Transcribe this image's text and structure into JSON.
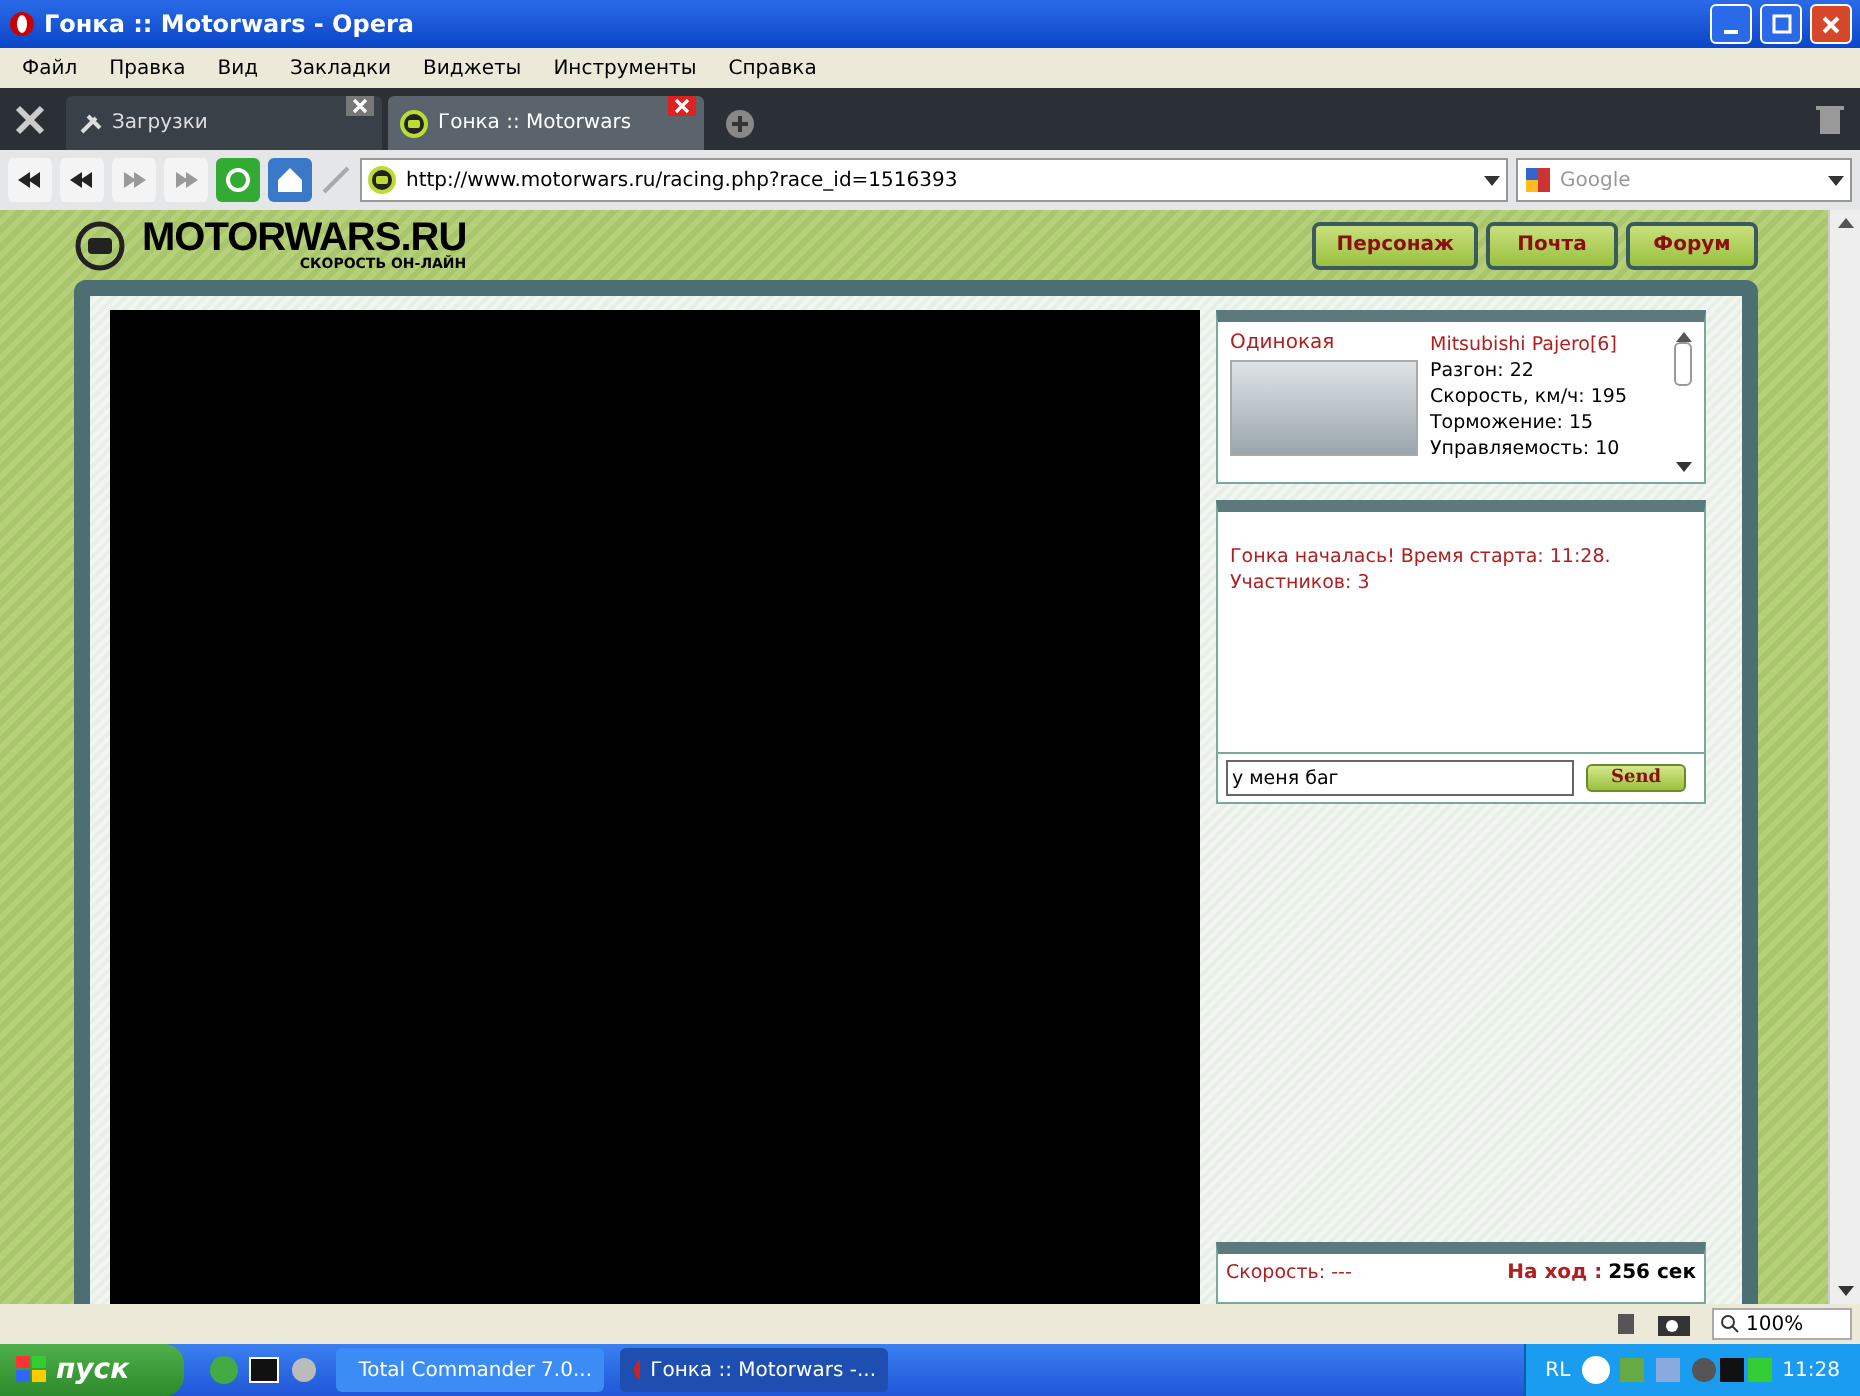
{
  "window": {
    "title": "Гонка :: Motorwars - Opera"
  },
  "menu": [
    "Файл",
    "Правка",
    "Вид",
    "Закладки",
    "Виджеты",
    "Инструменты",
    "Справка"
  ],
  "tabs": [
    {
      "label": "Загрузки",
      "selected": false
    },
    {
      "label": "Гонка :: Motorwars",
      "selected": true
    }
  ],
  "address_bar": {
    "url": "http://www.motorwars.ru/racing.php?race_id=1516393",
    "search_placeholder": "Google"
  },
  "site": {
    "logo": "MOTORWARS.RU",
    "tagline": "СКОРОСТЬ ОН-ЛАЙН",
    "nav": [
      "Персонаж",
      "Почта",
      "Форум"
    ]
  },
  "player": {
    "status": "Одинокая",
    "car": "Mitsubishi Pajero[6]",
    "stats": [
      "Разгон: 22",
      "Скорость, км/ч: 195",
      "Торможение: 15",
      "Управляемость: 10"
    ]
  },
  "chat": {
    "messages": [
      "Гонка началась! Время старта: 11:28.",
      "Участников: 3"
    ],
    "input": "у меня баг",
    "send": "Send"
  },
  "race_info": {
    "speed": "Скорость: ---",
    "turn_label": "На ход :",
    "turn_value": "256 сек"
  },
  "status_bar": {
    "zoom": "100%"
  },
  "taskbar": {
    "start": "пуск",
    "windows": [
      {
        "label": "Total Commander 7.0...",
        "selected": false
      },
      {
        "label": "Гонка :: Motorwars -...",
        "selected": true
      }
    ],
    "lang": "RL",
    "clock": "11:28"
  }
}
